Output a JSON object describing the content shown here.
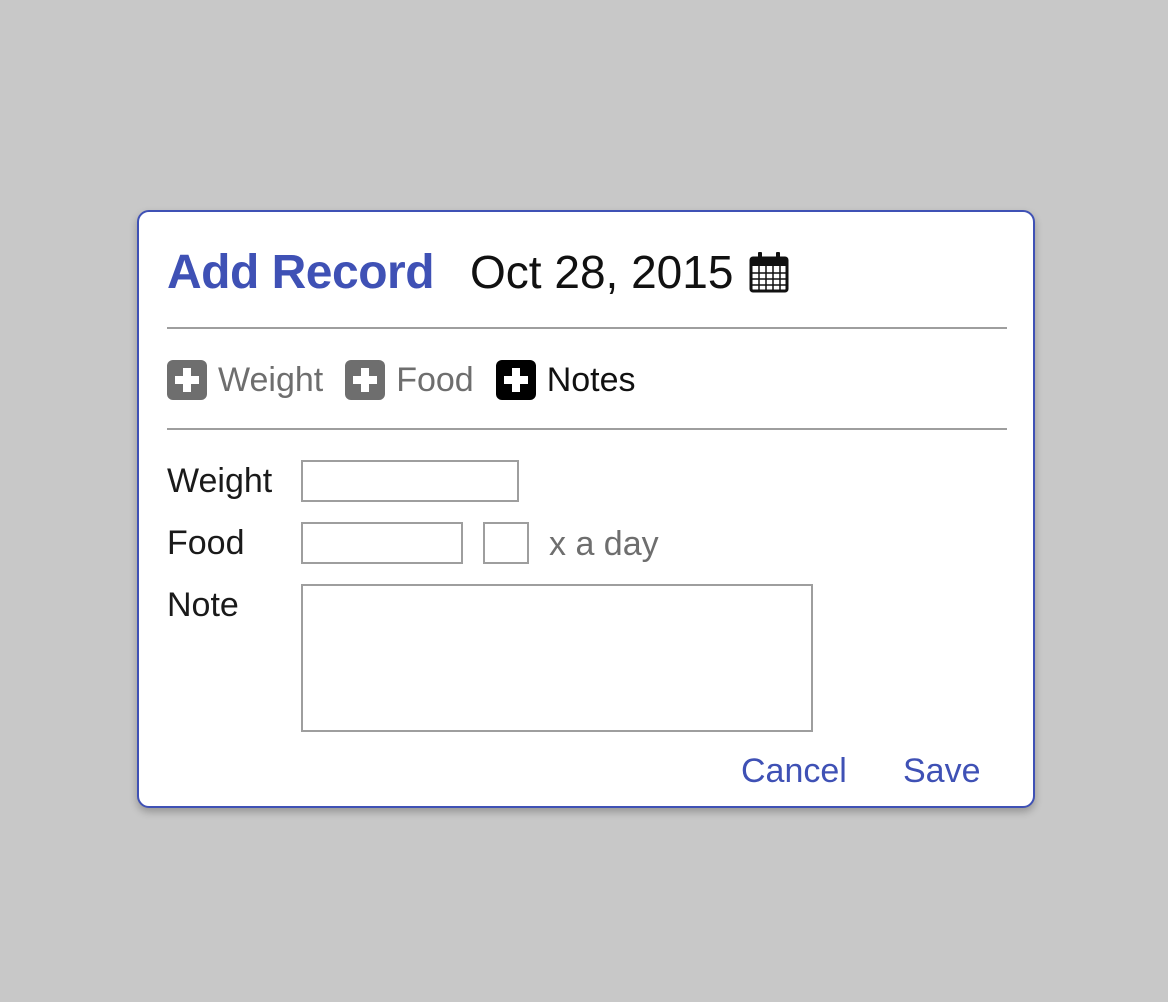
{
  "dialog": {
    "title": "Add Record",
    "date": "Oct 28, 2015",
    "date_icon": "calendar-icon"
  },
  "toggles": [
    {
      "label": "Weight",
      "icon": "plus-icon",
      "active": false
    },
    {
      "label": "Food",
      "icon": "plus-icon",
      "active": false
    },
    {
      "label": "Notes",
      "icon": "plus-icon",
      "active": true
    }
  ],
  "form": {
    "weight_label": "Weight",
    "food_label": "Food",
    "frequency_suffix": "x a day",
    "note_label": "Note",
    "weight_value": "",
    "food_value": "",
    "frequency_value": "",
    "note_value": ""
  },
  "actions": {
    "cancel_label": "Cancel",
    "save_label": "Save"
  },
  "colors": {
    "accent": "#3f51b5",
    "background": "#c8c8c8",
    "inactive": "#6e6e6e",
    "active": "#000000"
  }
}
